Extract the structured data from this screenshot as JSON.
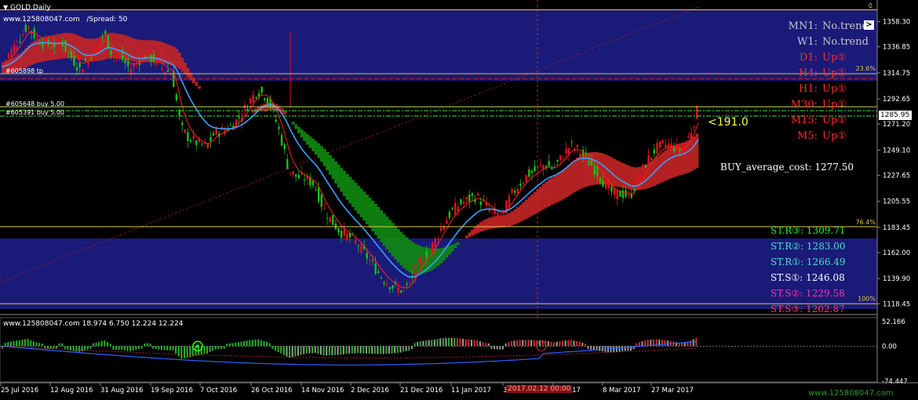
{
  "colors": {
    "background": "#000000",
    "band_blue": "#1a1a78",
    "bull": "#e0121c",
    "bear": "#17c117",
    "ma_fast": "#ff2020",
    "ma_slow": "#3aa0ff",
    "cloud_up": "#0f8a0f",
    "cloud_down": "#c42525",
    "fib_line": "#e6c44a",
    "label_white": "#ffffff",
    "label_red": "#ff2a2a",
    "label_yellow": "#ffff40",
    "st_green": "#22ee22",
    "st_cyan": "#48e0c8",
    "st_magenta": "#ff30b0",
    "st_red": "#ff4040",
    "axis_text": "#ffffff",
    "watermark_green": "#2c9a2c"
  },
  "header": {
    "symbol": "GOLD,Daily",
    "site": "www.125808047.com",
    "spread": "/Spread:  50"
  },
  "trend_panel": {
    "rows": [
      {
        "tf": "MN1:",
        "value": "No.trend",
        "color": "#c8c8c8"
      },
      {
        "tf": "W1:",
        "value": "No.trend",
        "color": "#c8c8c8"
      },
      {
        "tf": "D1:",
        "value": "Up①",
        "color": "#ff2a2a"
      },
      {
        "tf": "H4:",
        "value": "Up①",
        "color": "#ff2a2a"
      },
      {
        "tf": "H1:",
        "value": "Up①",
        "color": "#ff2a2a"
      },
      {
        "tf": "M30:",
        "value": "Up①",
        "color": "#ff2a2a"
      },
      {
        "tf": "M15:",
        "value": "Up①",
        "color": "#ff2a2a"
      },
      {
        "tf": "M5:",
        "value": "Up①",
        "color": "#ff2a2a"
      }
    ],
    "toggle_glyph": ">"
  },
  "buy_average": {
    "label": "BUY_average_cost:",
    "value": "1277.50"
  },
  "pip_label": "<191.0",
  "st_levels": [
    {
      "label": "ST.R③",
      "value": ": 1309.71",
      "color": "#22ee22"
    },
    {
      "label": "ST.R②",
      "value": ": 1283.00",
      "color": "#48e0c8"
    },
    {
      "label": "ST.R①",
      "value": ": 1266.49",
      "color": "#48e0c8"
    },
    {
      "label": "ST.S①",
      "value": ": 1246.08",
      "color": "#ffffff"
    },
    {
      "label": "ST.S②",
      "value": ": 1229.58",
      "color": "#ff30b0"
    },
    {
      "label": "ST.S③",
      "value": ": 1202.87",
      "color": "#ff4040"
    }
  ],
  "fib_labels": {
    "top": "0",
    "f236": "23.6%",
    "f764": "76.4%",
    "f100": "100%"
  },
  "order_labels": [
    {
      "text": "#605898 tp",
      "price": 1314.0
    },
    {
      "text": "#605648 buy 5.00",
      "price": 1285.9
    },
    {
      "text": "#605391 buy 5.00",
      "price": 1282.6
    }
  ],
  "current_price": "1285.95",
  "price_axis": {
    "min": 1110,
    "max": 1368,
    "ticks": [
      "1358.30",
      "1336.85",
      "1314.75",
      "1292.65",
      "1271.20",
      "1249.10",
      "1227.65",
      "1205.55",
      "1183.45",
      "1162.00",
      "1139.90",
      "1118.45"
    ]
  },
  "sub_indicator": {
    "title": "www.125808047.com 18.974 6.750 12.224 12.224",
    "ticks": [
      "52.166",
      "0.00",
      "-74.447"
    ]
  },
  "time_axis": {
    "labels": [
      "25 Jul 2016",
      "12 Aug 2016",
      "31 Aug 2016",
      "19 Sep 2016",
      "7 Oct 2016",
      "26 Oct 2016",
      "14 Nov 2016",
      "2 Dec 2016",
      "21 Dec 2016",
      "11 Jan 2017",
      "3",
      "eb 2017",
      "8 Mar 2017",
      "27 Mar 2017"
    ],
    "cursor_label": "2017.02.12 00:00"
  },
  "watermark": "www.125808047.com",
  "chart_data": {
    "type": "candlestick",
    "title": "GOLD,Daily",
    "ylim": [
      1110,
      1368
    ],
    "x": [
      "25 Jul 2016",
      "12 Aug 2016",
      "31 Aug 2016",
      "19 Sep 2016",
      "7 Oct 2016",
      "26 Oct 2016",
      "14 Nov 2016",
      "2 Dec 2016",
      "21 Dec 2016",
      "11 Jan 2017",
      "eb 2017",
      "8 Mar 2017",
      "27 Mar 2017"
    ],
    "close_path": [
      [
        0,
        1320
      ],
      [
        6,
        1332
      ],
      [
        12,
        1342
      ],
      [
        18,
        1355
      ],
      [
        24,
        1345
      ],
      [
        30,
        1340
      ],
      [
        36,
        1338
      ],
      [
        42,
        1342
      ],
      [
        48,
        1330
      ],
      [
        55,
        1318
      ],
      [
        60,
        1326
      ],
      [
        66,
        1335
      ],
      [
        72,
        1349
      ],
      [
        78,
        1330
      ],
      [
        84,
        1328
      ],
      [
        90,
        1318
      ],
      [
        96,
        1325
      ],
      [
        102,
        1330
      ],
      [
        108,
        1325
      ],
      [
        114,
        1318
      ],
      [
        120,
        1314
      ],
      [
        126,
        1268
      ],
      [
        132,
        1259
      ],
      [
        138,
        1255
      ],
      [
        144,
        1252
      ],
      [
        150,
        1264
      ],
      [
        156,
        1266
      ],
      [
        162,
        1270
      ],
      [
        168,
        1278
      ],
      [
        174,
        1290
      ],
      [
        180,
        1300
      ],
      [
        186,
        1295
      ],
      [
        190,
        1285
      ],
      [
        196,
        1262
      ],
      [
        202,
        1232
      ],
      [
        208,
        1226
      ],
      [
        214,
        1225
      ],
      [
        220,
        1220
      ],
      [
        226,
        1200
      ],
      [
        232,
        1189
      ],
      [
        238,
        1180
      ],
      [
        244,
        1176
      ],
      [
        250,
        1170
      ],
      [
        256,
        1160
      ],
      [
        262,
        1150
      ],
      [
        268,
        1140
      ],
      [
        274,
        1134
      ],
      [
        280,
        1130
      ],
      [
        286,
        1133
      ],
      [
        292,
        1150
      ],
      [
        298,
        1160
      ],
      [
        304,
        1170
      ],
      [
        310,
        1185
      ],
      [
        316,
        1196
      ],
      [
        322,
        1203
      ],
      [
        328,
        1207
      ],
      [
        334,
        1210
      ],
      [
        340,
        1202
      ],
      [
        346,
        1196
      ],
      [
        352,
        1193
      ],
      [
        358,
        1210
      ],
      [
        364,
        1220
      ],
      [
        370,
        1228
      ],
      [
        376,
        1232
      ],
      [
        382,
        1237
      ],
      [
        388,
        1233
      ],
      [
        394,
        1243
      ],
      [
        400,
        1253
      ],
      [
        406,
        1249
      ],
      [
        412,
        1240
      ],
      [
        418,
        1232
      ],
      [
        424,
        1221
      ],
      [
        430,
        1212
      ],
      [
        436,
        1212
      ],
      [
        442,
        1210
      ],
      [
        448,
        1226
      ],
      [
        454,
        1240
      ],
      [
        460,
        1250
      ],
      [
        466,
        1254
      ],
      [
        472,
        1252
      ],
      [
        478,
        1248
      ],
      [
        484,
        1262
      ],
      [
        490,
        1286
      ]
    ],
    "indicators": [
      "MA fast (red)",
      "MA slow (blue)",
      "Cloud (green / red)"
    ],
    "sub_histogram": {
      "min": -74.447,
      "max": 52.166
    }
  }
}
